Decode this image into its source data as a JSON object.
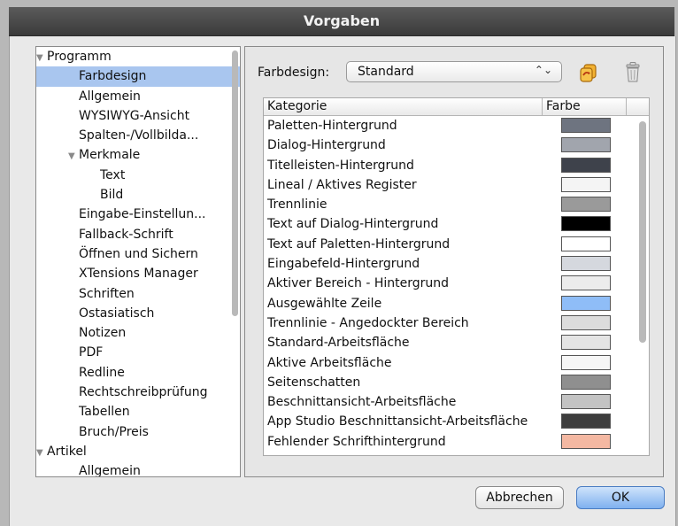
{
  "window": {
    "title": "Vorgaben"
  },
  "tree": {
    "items": [
      {
        "label": "Programm",
        "level": 0,
        "expanded": true,
        "selected": false
      },
      {
        "label": "Farbdesign",
        "level": 1,
        "selected": true
      },
      {
        "label": "Allgemein",
        "level": 1
      },
      {
        "label": "WYSIWYG-Ansicht",
        "level": 1
      },
      {
        "label": "Spalten-/Vollbilda...",
        "level": 1
      },
      {
        "label": "Merkmale",
        "level": 1,
        "expanded": true
      },
      {
        "label": "Text",
        "level": 2
      },
      {
        "label": "Bild",
        "level": 2
      },
      {
        "label": "Eingabe-Einstellun...",
        "level": 1
      },
      {
        "label": "Fallback-Schrift",
        "level": 1
      },
      {
        "label": "Öffnen und Sichern",
        "level": 1
      },
      {
        "label": "XTensions Manager",
        "level": 1
      },
      {
        "label": "Schriften",
        "level": 1
      },
      {
        "label": "Ostasiatisch",
        "level": 1
      },
      {
        "label": "Notizen",
        "level": 1
      },
      {
        "label": "PDF",
        "level": 1
      },
      {
        "label": "Redline",
        "level": 1
      },
      {
        "label": "Rechtschreibprüfung",
        "level": 1
      },
      {
        "label": "Tabellen",
        "level": 1
      },
      {
        "label": "Bruch/Preis",
        "level": 1
      },
      {
        "label": "Artikel",
        "level": 0,
        "expanded": true
      },
      {
        "label": "Allgemein",
        "level": 1
      }
    ]
  },
  "scheme": {
    "label": "Farbdesign:",
    "value": "Standard",
    "arrows": "⌃⌄"
  },
  "toolbar": {
    "duplicate_icon": "duplicate-icon",
    "delete_icon": "trash-icon"
  },
  "table": {
    "headers": {
      "category": "Kategorie",
      "color": "Farbe"
    },
    "rows": [
      {
        "label": "Paletten-Hintergrund",
        "color": "#6e7480"
      },
      {
        "label": "Dialog-Hintergrund",
        "color": "#a1a5ad"
      },
      {
        "label": "Titelleisten-Hintergrund",
        "color": "#3e424b"
      },
      {
        "label": "Lineal / Aktives Register",
        "color": "#f4f4f4"
      },
      {
        "label": "Trennlinie",
        "color": "#9a9a9a"
      },
      {
        "label": "Text auf Dialog-Hintergrund",
        "color": "#000000"
      },
      {
        "label": "Text auf Paletten-Hintergrund",
        "color": "#ffffff"
      },
      {
        "label": "Eingabefeld-Hintergrund",
        "color": "#d5d8de"
      },
      {
        "label": "Aktiver Bereich - Hintergrund",
        "color": "#ececec"
      },
      {
        "label": "Ausgewählte Zeile",
        "color": "#8fbdf7"
      },
      {
        "label": "Trennlinie - Angedockter Bereich",
        "color": "#dcdcdc"
      },
      {
        "label": "Standard-Arbeitsfläche",
        "color": "#e4e4e4"
      },
      {
        "label": "Aktive Arbeitsfläche",
        "color": "#f6f6f6"
      },
      {
        "label": "Seitenschatten",
        "color": "#8f8f8f"
      },
      {
        "label": "Beschnittansicht-Arbeitsfläche",
        "color": "#c3c3c3"
      },
      {
        "label": "App Studio Beschnittansicht-Arbeitsfläche",
        "color": "#3e3e3e"
      },
      {
        "label": "Fehlender Schrifthintergrund",
        "color": "#f4b8a2"
      }
    ]
  },
  "buttons": {
    "cancel": "Abbrechen",
    "ok": "OK"
  }
}
